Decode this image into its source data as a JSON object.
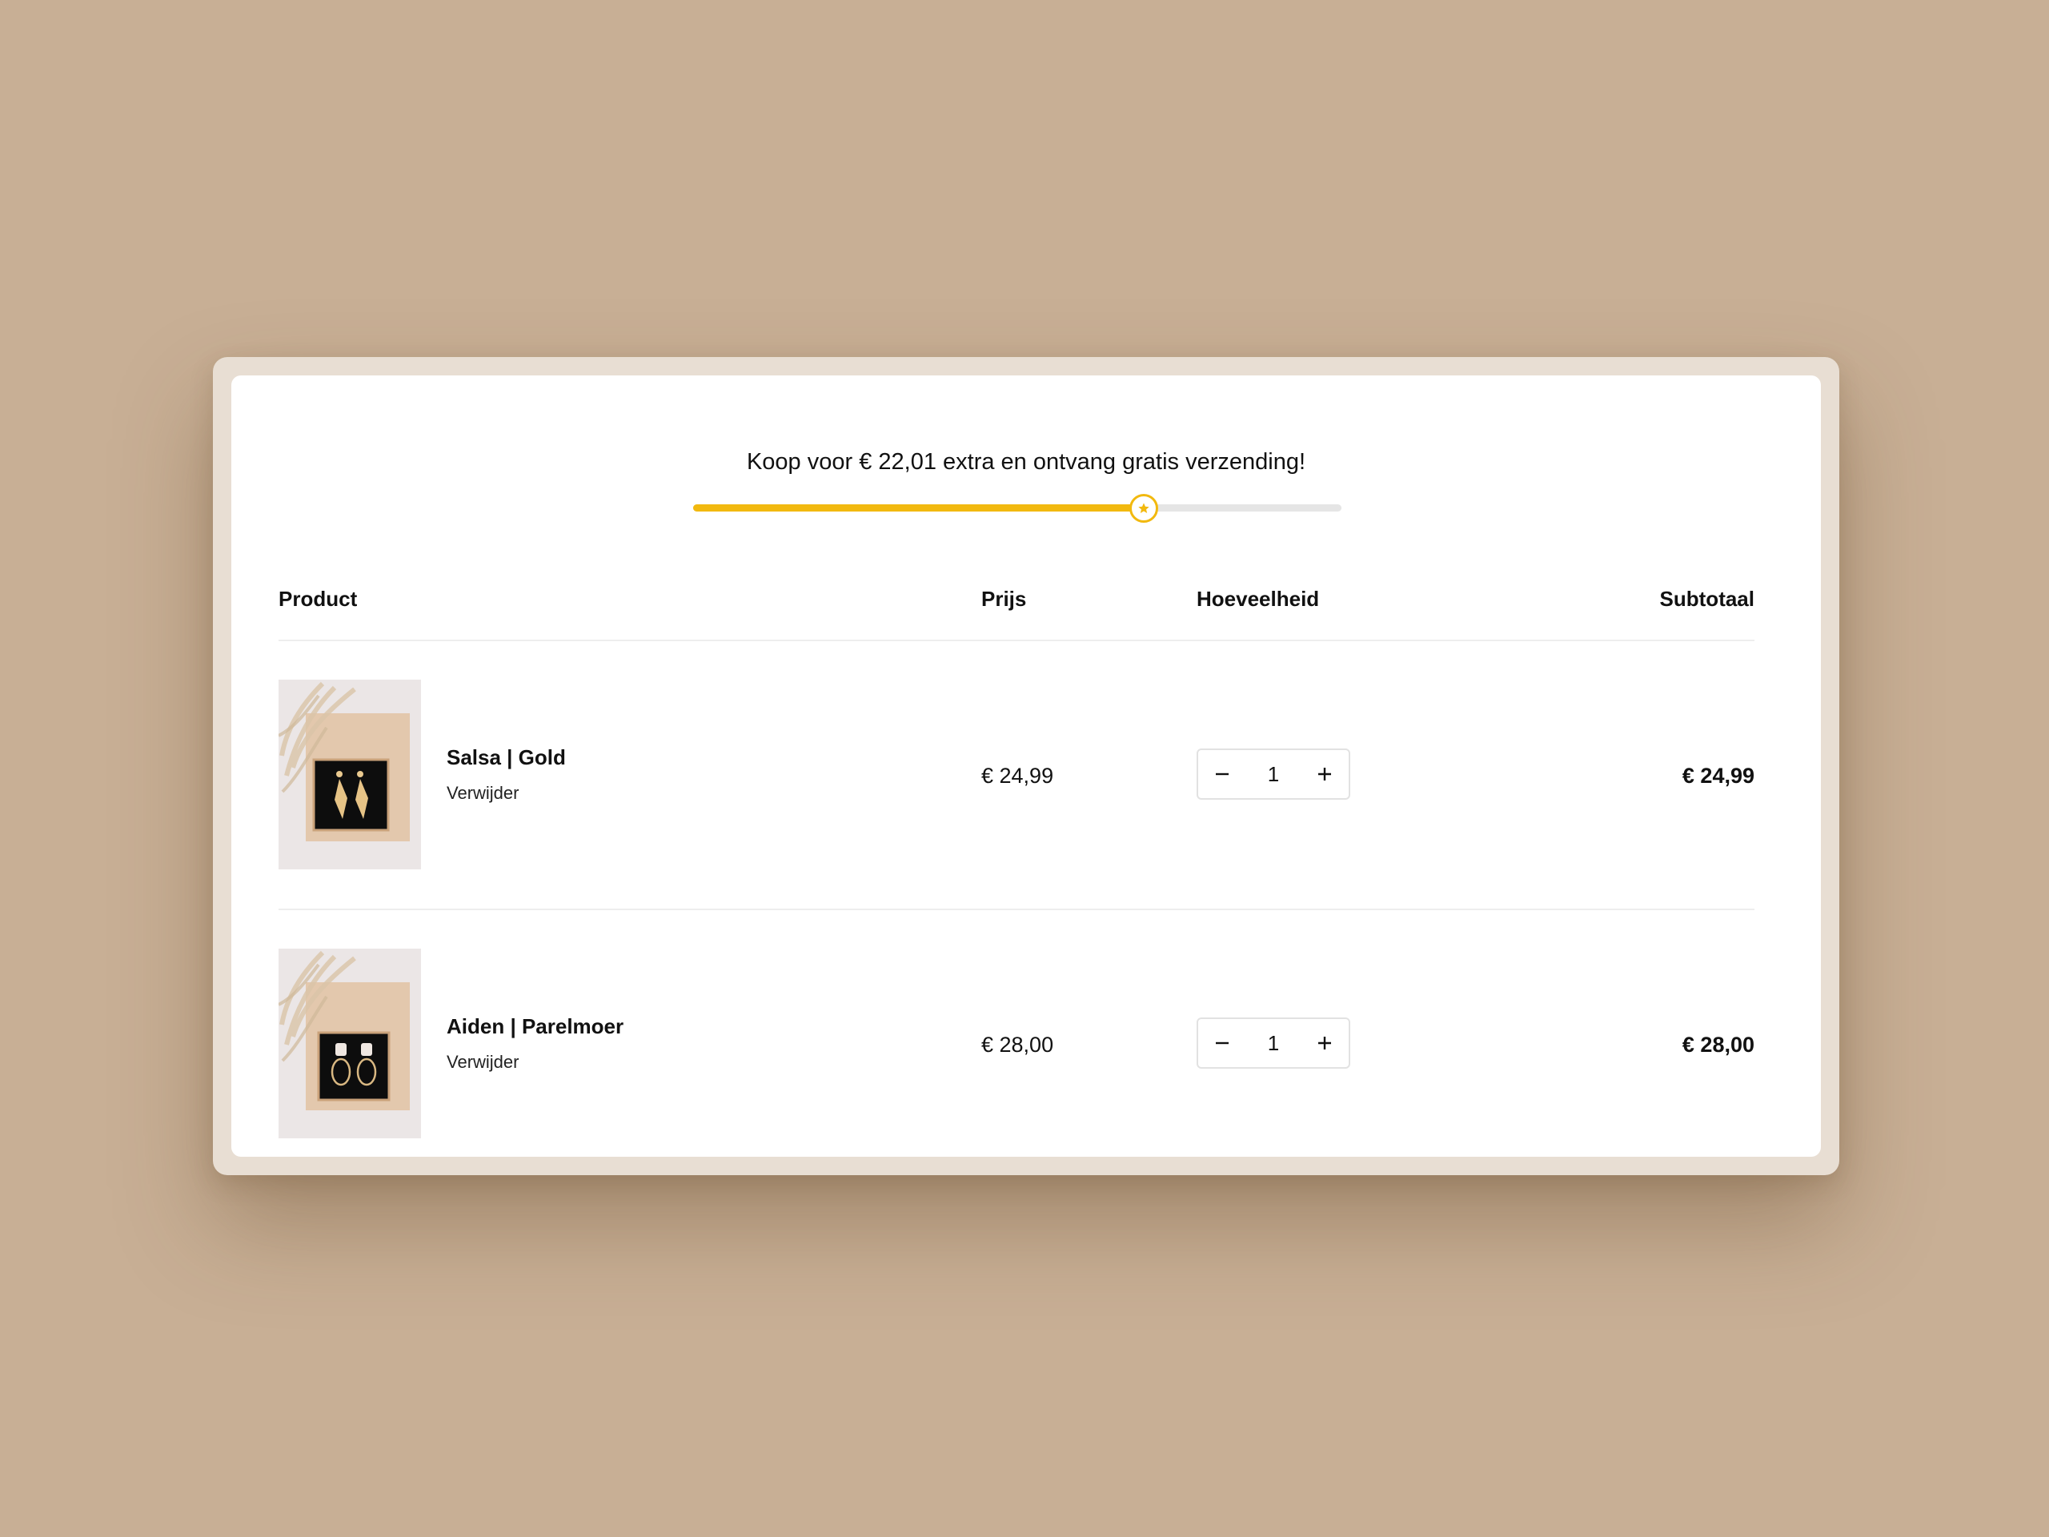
{
  "shipping": {
    "message": "Koop voor € 22,01 extra en ontvang gratis verzending!",
    "progress": 0.695,
    "accent_color": "#f2b90f",
    "icon": "star-icon"
  },
  "table": {
    "headers": {
      "product": "Product",
      "price": "Prijs",
      "quantity": "Hoeveelheid",
      "subtotal": "Subtotaal"
    }
  },
  "items": [
    {
      "name": "Salsa | Gold",
      "remove_label": "Verwijder",
      "price": "€ 24,99",
      "quantity": "1",
      "subtotal": "€ 24,99",
      "image_icon": "earring-leaf-gold-icon"
    },
    {
      "name": "Aiden | Parelmoer",
      "remove_label": "Verwijder",
      "price": "€ 28,00",
      "quantity": "1",
      "subtotal": "€ 28,00",
      "image_icon": "earring-hoop-pearl-icon"
    }
  ]
}
